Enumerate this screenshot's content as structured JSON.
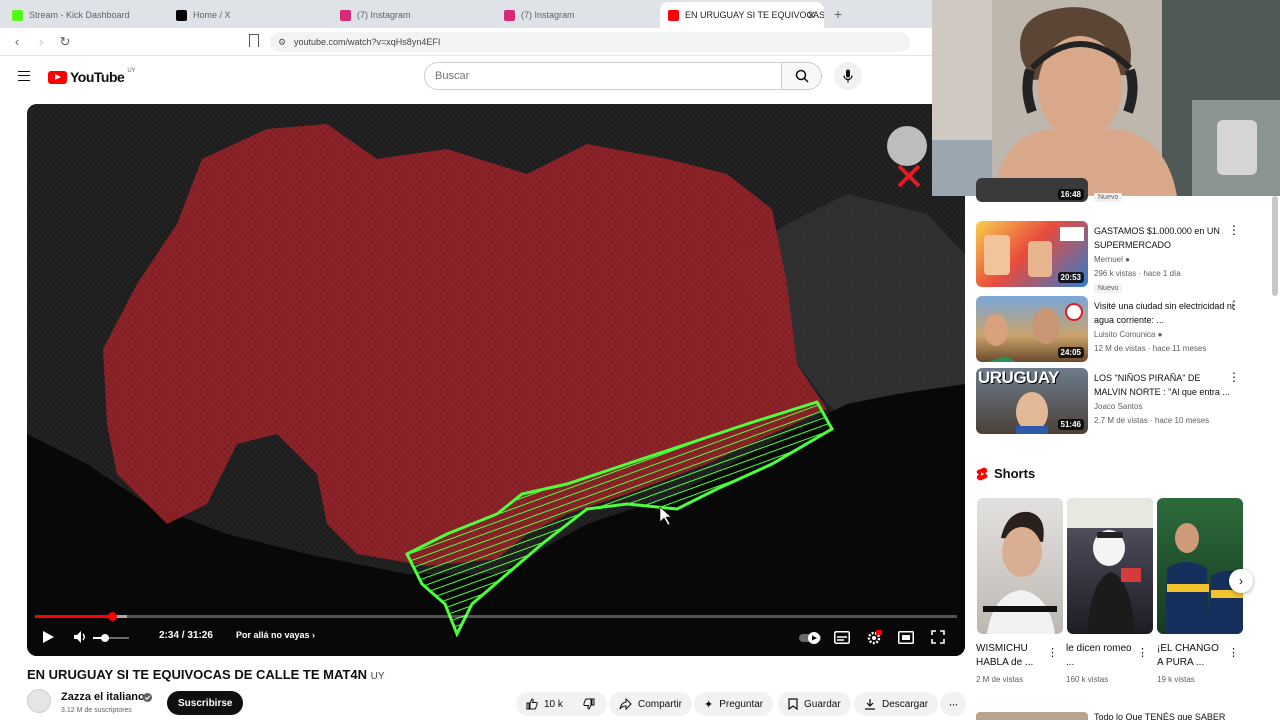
{
  "browser": {
    "tabs": [
      {
        "title": "Stream - Kick Dashboard",
        "color": "#53fc18"
      },
      {
        "title": "Home / X",
        "color": "#000000"
      },
      {
        "title": "(7) Instagram",
        "color": "#d62976"
      },
      {
        "title": "(7) Instagram",
        "color": "#d62976"
      },
      {
        "title": "EN URUGUAY SI TE EQUIVOCAS",
        "color": "#ff0000"
      }
    ],
    "url": "youtube.com/watch?v=xqHs8yn4EFI"
  },
  "youtube": {
    "logo_text": "YouTube",
    "logo_country": "UY",
    "search_placeholder": "Buscar"
  },
  "player": {
    "time": "2:34 / 31:26",
    "chapter": "Por allá no vayas",
    "progress_played": 0.084,
    "progress_loaded": 0.1
  },
  "video": {
    "title": "EN URUGUAY SI TE EQUIVOCAS DE CALLE TE MAT4N",
    "title_suffix": "UY",
    "channel": "Zazza el italiano",
    "subscribers": "3.12 M de suscriptores",
    "subscribe_label": "Suscribirse",
    "likes": "10 k",
    "share_label": "Compartir",
    "ask_label": "Preguntar",
    "save_label": "Guardar",
    "download_label": "Descargar"
  },
  "sidebar": {
    "top_partial": {
      "duration": "16:48",
      "badge": "Nuevo"
    },
    "videos": [
      {
        "title": "GASTAMOS $1.000.000 en UN SUPERMERCADO",
        "channel": "Mernuel",
        "meta": "296 k vistas · hace 1 día",
        "duration": "20:53",
        "badge": "Nuevo"
      },
      {
        "title": "Visité una ciudad sin electricidad ni agua corriente: ...",
        "channel": "Luisito Comunica",
        "meta": "12 M de vistas · hace 11 meses",
        "duration": "24:05"
      },
      {
        "title": "LOS \"NIÑOS PIRAÑA\" DE MALVIN NORTE : \"Al que entra ...",
        "channel": "Joaco Santos",
        "meta": "2.7 M de vistas · hace 10 meses",
        "duration": "51:46",
        "thumb_text": "URUGUAY"
      }
    ],
    "shorts_heading": "Shorts",
    "shorts": [
      {
        "title": "WISMICHU HABLA de ...",
        "views": "2 M de vistas"
      },
      {
        "title": "le dicen romeo ...",
        "views": "160 k vistas"
      },
      {
        "title": "¡EL CHANGO A PURA ...",
        "views": "19 k vistas"
      }
    ],
    "bottom_partial_title": "Todo lo Que TENÉS que SABER"
  }
}
